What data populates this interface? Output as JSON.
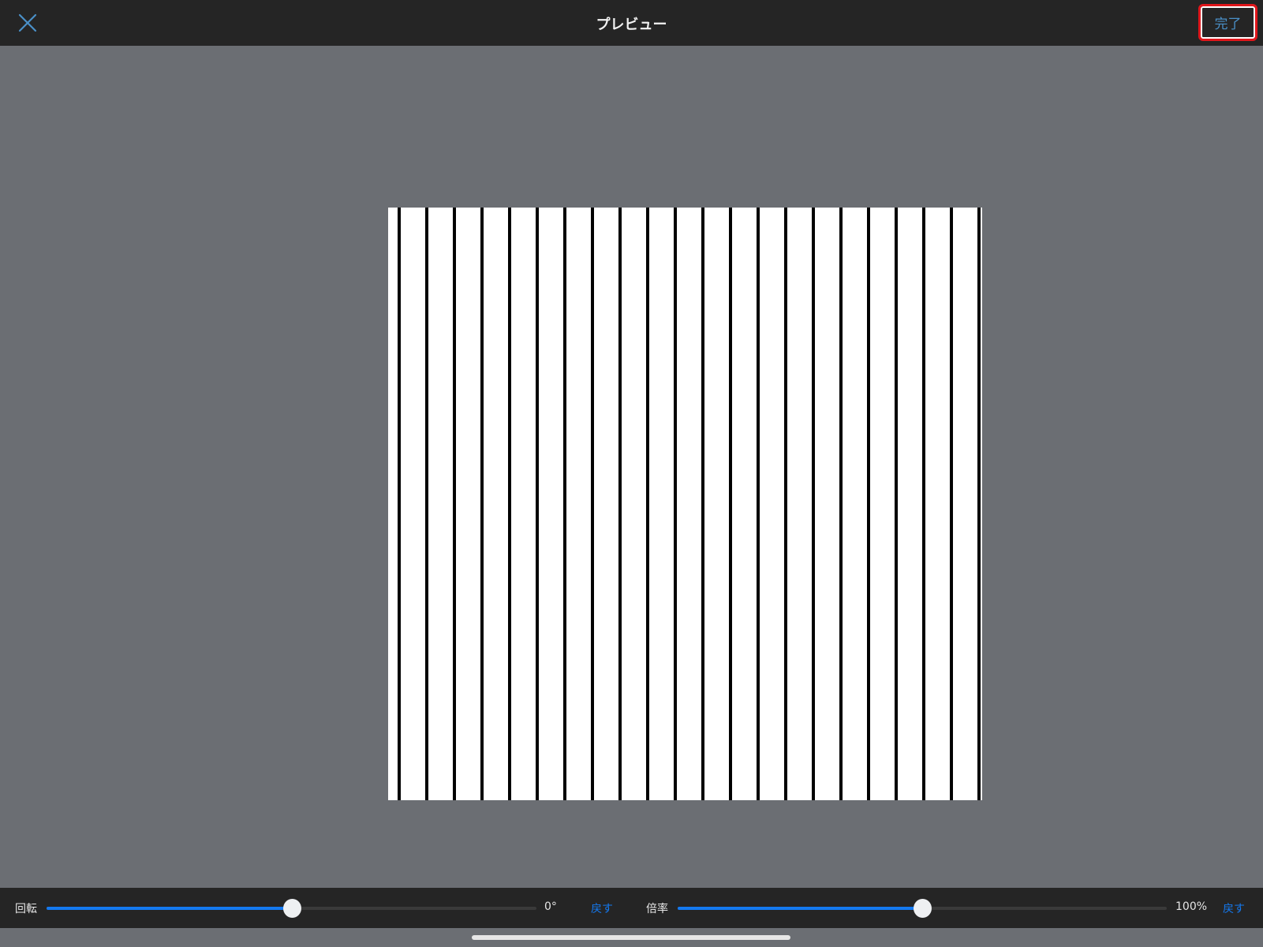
{
  "header": {
    "title": "プレビュー",
    "done_label": "完了",
    "close_icon": "close-icon"
  },
  "preview": {
    "stripe_count": 22
  },
  "controls": {
    "rotation": {
      "label": "回転",
      "value": "0°",
      "fraction": 0.5,
      "reset_label": "戻す"
    },
    "scale": {
      "label": "倍率",
      "value": "100%",
      "fraction": 0.5,
      "reset_label": "戻す"
    }
  },
  "colors": {
    "accent": "#1479f0",
    "highlight": "#e0161b"
  }
}
